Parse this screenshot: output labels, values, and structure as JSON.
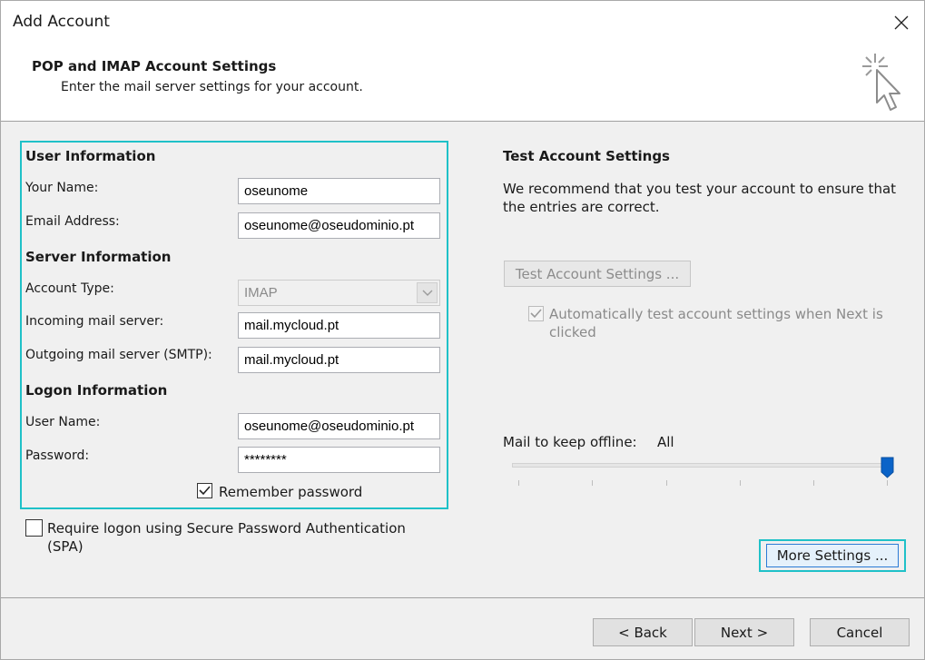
{
  "window": {
    "title": "Add Account"
  },
  "header": {
    "title": "POP and IMAP Account Settings",
    "subtitle": "Enter the mail server settings for your account."
  },
  "user_info": {
    "heading": "User Information",
    "name_label": "Your Name:",
    "name_value": "oseunome",
    "email_label": "Email Address:",
    "email_value": "oseunome@oseudominio.pt"
  },
  "server_info": {
    "heading": "Server Information",
    "account_type_label": "Account Type:",
    "account_type_value": "IMAP",
    "incoming_label": "Incoming mail server:",
    "incoming_value": "mail.mycloud.pt",
    "outgoing_label": "Outgoing mail server (SMTP):",
    "outgoing_value": "mail.mycloud.pt"
  },
  "logon_info": {
    "heading": "Logon Information",
    "username_label": "User Name:",
    "username_value": "oseunome@oseudominio.pt",
    "password_label": "Password:",
    "password_value": "********",
    "remember_label": "Remember password",
    "remember_checked": true
  },
  "spa": {
    "label": "Require logon using Secure Password Authentication (SPA)",
    "checked": false
  },
  "test_settings": {
    "heading": "Test Account Settings",
    "description": "We recommend that you test your account to ensure that the entries are correct.",
    "button_label": "Test Account Settings ...",
    "auto_test_label": "Automatically test account settings when Next is clicked",
    "auto_test_checked": true
  },
  "offline": {
    "label": "Mail to keep offline:",
    "value": "All",
    "slider_level": 1.0
  },
  "buttons": {
    "more_settings": "More Settings ...",
    "back": "< Back",
    "next": "Next >",
    "cancel": "Cancel"
  },
  "colors": {
    "highlight": "#1fc1c8",
    "slider_thumb": "#0a63c8"
  },
  "icons": {
    "close": "close-icon",
    "wizard": "cursor-sparkle-icon",
    "dropdown": "chevron-down-icon"
  }
}
